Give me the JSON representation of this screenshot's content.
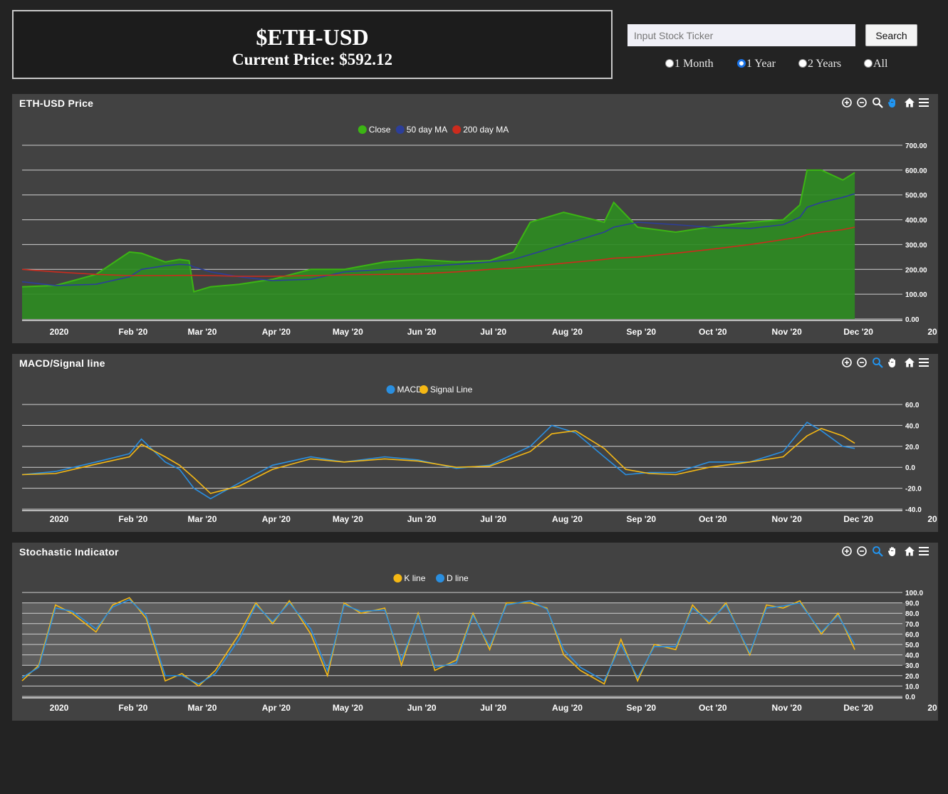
{
  "header": {
    "ticker": "$ETH-USD",
    "price_label": "Current Price: $592.12"
  },
  "search": {
    "placeholder": "Input Stock Ticker",
    "button_label": "Search"
  },
  "ranges": {
    "options": [
      "1 Month",
      "1 Year",
      "2 Years",
      "All"
    ],
    "selected": "1 Year"
  },
  "x_axis_labels": [
    "2020",
    "Feb '20",
    "Mar '20",
    "Apr '20",
    "May '20",
    "Jun '20",
    "Jul '20",
    "Aug '20",
    "Sep '20",
    "Oct '20",
    "Nov '20",
    "Dec '20",
    "20"
  ],
  "colors": {
    "close": "#3cb514",
    "ma50": "#2c3e99",
    "ma200": "#cc2b1d",
    "macd": "#2a8fe0",
    "signal": "#f5b814",
    "k": "#f5b814",
    "d": "#2a8fe0"
  },
  "toolbar_icons": [
    "zoom-in-icon",
    "zoom-out-icon",
    "magnify-icon",
    "pan-hand-icon",
    "home-icon",
    "menu-icon"
  ],
  "chart_data": [
    {
      "type": "area",
      "title": "ETH-USD Price",
      "legend": [
        "Close",
        "50 day MA",
        "200 day MA"
      ],
      "legend_position": "top-center",
      "ylim": [
        0,
        700
      ],
      "y_ticks": [
        "700.00",
        "600.00",
        "500.00",
        "400.00",
        "300.00",
        "200.00",
        "100.00",
        "0.00"
      ],
      "x": [
        "2020-01-01",
        "2020-01-15",
        "2020-02-01",
        "2020-02-15",
        "2020-02-20",
        "2020-03-01",
        "2020-03-07",
        "2020-03-11",
        "2020-03-13",
        "2020-03-20",
        "2020-04-01",
        "2020-04-15",
        "2020-05-01",
        "2020-05-15",
        "2020-06-01",
        "2020-06-15",
        "2020-07-01",
        "2020-07-15",
        "2020-07-25",
        "2020-08-01",
        "2020-08-15",
        "2020-09-01",
        "2020-09-05",
        "2020-09-15",
        "2020-10-01",
        "2020-10-15",
        "2020-11-01",
        "2020-11-15",
        "2020-11-22",
        "2020-11-25",
        "2020-12-01",
        "2020-12-10",
        "2020-12-15"
      ],
      "series": [
        {
          "name": "Close",
          "values": [
            130,
            135,
            180,
            270,
            265,
            230,
            240,
            235,
            110,
            130,
            140,
            160,
            200,
            200,
            230,
            240,
            230,
            235,
            270,
            390,
            430,
            390,
            470,
            370,
            350,
            370,
            390,
            400,
            460,
            600,
            600,
            560,
            590
          ]
        },
        {
          "name": "50 day MA",
          "values": [
            150,
            135,
            140,
            170,
            200,
            215,
            220,
            218,
            210,
            190,
            170,
            155,
            160,
            190,
            200,
            210,
            220,
            230,
            240,
            260,
            300,
            350,
            370,
            390,
            380,
            370,
            365,
            380,
            410,
            450,
            470,
            490,
            505
          ]
        },
        {
          "name": "200 day MA",
          "values": [
            200,
            190,
            180,
            175,
            175,
            175,
            176,
            176,
            176,
            175,
            172,
            172,
            175,
            178,
            180,
            182,
            190,
            200,
            205,
            212,
            225,
            240,
            245,
            250,
            265,
            280,
            300,
            320,
            330,
            340,
            350,
            360,
            370
          ]
        }
      ]
    },
    {
      "type": "line",
      "title": "MACD/Signal line",
      "legend": [
        "MACD",
        "Signal Line"
      ],
      "legend_position": "top-center",
      "ylim": [
        -40,
        60
      ],
      "y_ticks": [
        "60.0",
        "40.0",
        "20.0",
        "0.0",
        "-20.0",
        "-40.0"
      ],
      "x": [
        "2020-01-01",
        "2020-01-15",
        "2020-02-01",
        "2020-02-15",
        "2020-02-20",
        "2020-03-01",
        "2020-03-07",
        "2020-03-13",
        "2020-03-20",
        "2020-04-01",
        "2020-04-15",
        "2020-05-01",
        "2020-05-15",
        "2020-06-01",
        "2020-06-15",
        "2020-07-01",
        "2020-07-15",
        "2020-08-01",
        "2020-08-10",
        "2020-08-20",
        "2020-09-01",
        "2020-09-10",
        "2020-09-20",
        "2020-10-01",
        "2020-10-15",
        "2020-11-01",
        "2020-11-15",
        "2020-11-25",
        "2020-12-01",
        "2020-12-10",
        "2020-12-15"
      ],
      "series": [
        {
          "name": "MACD",
          "values": [
            -7,
            -4,
            5,
            13,
            27,
            5,
            -2,
            -20,
            -30,
            -15,
            2,
            10,
            5,
            10,
            7,
            -1,
            2,
            20,
            40,
            33,
            10,
            -7,
            -5,
            -5,
            5,
            5,
            15,
            43,
            35,
            20,
            18
          ]
        },
        {
          "name": "Signal Line",
          "values": [
            -7,
            -6,
            3,
            10,
            22,
            10,
            2,
            -10,
            -25,
            -18,
            -2,
            8,
            5,
            8,
            6,
            0,
            1,
            15,
            32,
            35,
            18,
            -2,
            -6,
            -7,
            0,
            5,
            10,
            30,
            37,
            30,
            23
          ]
        }
      ]
    },
    {
      "type": "line",
      "title": "Stochastic Indicator",
      "legend": [
        "K line",
        "D line"
      ],
      "legend_position": "top-center",
      "ylim": [
        0,
        100
      ],
      "y_ticks": [
        "100.0",
        "90.0",
        "80.0",
        "70.0",
        "60.0",
        "50.0",
        "40.0",
        "30.0",
        "20.0",
        "10.0",
        "0.0"
      ],
      "x": [
        "2020-01-01",
        "2020-01-08",
        "2020-01-15",
        "2020-01-22",
        "2020-02-01",
        "2020-02-08",
        "2020-02-15",
        "2020-02-22",
        "2020-03-01",
        "2020-03-08",
        "2020-03-15",
        "2020-03-22",
        "2020-04-01",
        "2020-04-08",
        "2020-04-15",
        "2020-04-22",
        "2020-05-01",
        "2020-05-08",
        "2020-05-15",
        "2020-05-22",
        "2020-06-01",
        "2020-06-08",
        "2020-06-15",
        "2020-06-22",
        "2020-07-01",
        "2020-07-08",
        "2020-07-15",
        "2020-07-22",
        "2020-08-01",
        "2020-08-08",
        "2020-08-15",
        "2020-08-22",
        "2020-09-01",
        "2020-09-08",
        "2020-09-15",
        "2020-09-22",
        "2020-10-01",
        "2020-10-08",
        "2020-10-15",
        "2020-10-22",
        "2020-11-01",
        "2020-11-08",
        "2020-11-15",
        "2020-11-22",
        "2020-12-01",
        "2020-12-08",
        "2020-12-15"
      ],
      "series": [
        {
          "name": "K line",
          "values": [
            15,
            30,
            88,
            80,
            62,
            88,
            95,
            75,
            15,
            22,
            10,
            25,
            60,
            90,
            70,
            92,
            60,
            20,
            90,
            80,
            85,
            30,
            80,
            25,
            35,
            80,
            45,
            90,
            90,
            85,
            40,
            25,
            12,
            55,
            15,
            50,
            45,
            88,
            70,
            90,
            40,
            88,
            85,
            92,
            60,
            80,
            45
          ]
        },
        {
          "name": "D line",
          "values": [
            18,
            28,
            85,
            82,
            65,
            86,
            93,
            78,
            20,
            20,
            12,
            22,
            55,
            88,
            72,
            90,
            65,
            25,
            88,
            82,
            83,
            35,
            78,
            28,
            32,
            78,
            48,
            88,
            92,
            84,
            45,
            28,
            15,
            50,
            18,
            48,
            48,
            85,
            72,
            88,
            42,
            85,
            87,
            90,
            62,
            78,
            50
          ]
        }
      ]
    }
  ]
}
